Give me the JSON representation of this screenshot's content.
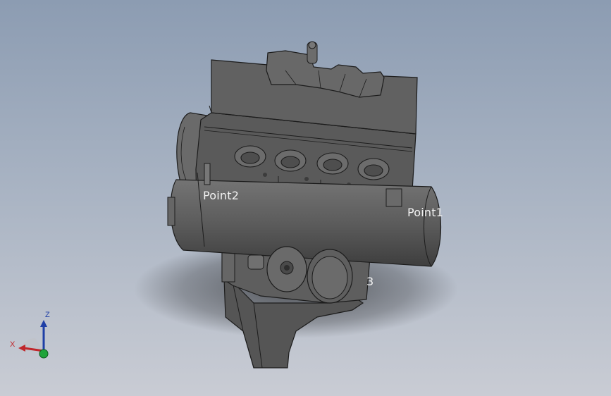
{
  "viewport": {
    "background_top": "#8c9cb2",
    "background_bottom": "#c9ccd4",
    "model_color": "#5a5a5a",
    "edge_color": "#1c1c1c"
  },
  "labels": {
    "point1": "Point1",
    "point2": "Point2",
    "point3": "3"
  },
  "triad": {
    "x_label": "X",
    "z_label": "Z",
    "x_color": "#c0262b",
    "z_color": "#1f3fa6",
    "y_color": "#1fa33a"
  }
}
